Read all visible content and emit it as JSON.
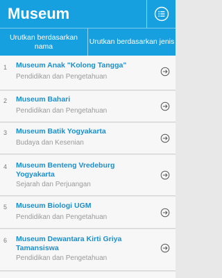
{
  "header": {
    "title": "Museum",
    "menu_icon": "list-menu-icon"
  },
  "sort": {
    "by_name": "Urutkan berdasarkan nama",
    "by_type": "Urutkan berdasarkan jenis"
  },
  "museums": [
    {
      "index": "1",
      "name": "Museum Anak \"Kolong Tangga\"",
      "category": "Pendidikan dan Pengetahuan"
    },
    {
      "index": "2",
      "name": "Museum Bahari",
      "category": "Pendidikan dan Pengetahuan"
    },
    {
      "index": "3",
      "name": "Museum Batik Yogyakarta",
      "category": "Budaya dan Kesenian"
    },
    {
      "index": "4",
      "name": "Museum Benteng Vredeburg Yogyakarta",
      "category": "Sejarah dan Perjuangan"
    },
    {
      "index": "5",
      "name": "Museum Biologi UGM",
      "category": "Pendidikan dan Pengetahuan"
    },
    {
      "index": "6",
      "name": "Museum Dewantara Kirti Griya Tamansiswa",
      "category": "Pendidikan dan Pengetahuan"
    }
  ],
  "colors": {
    "brand": "#16a0e0",
    "item_title": "#1a8fcd",
    "item_subtitle": "#9a9a9a"
  }
}
